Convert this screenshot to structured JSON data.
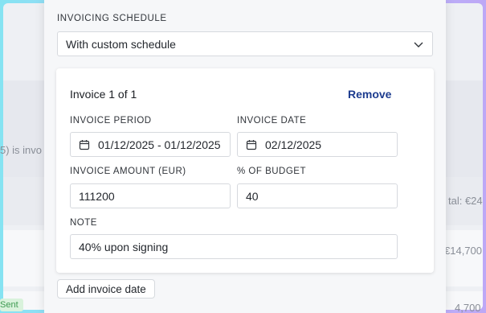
{
  "background": {
    "text_left": "5) is invo",
    "total_text": "tal: €24",
    "amount_row_1": "€14,700",
    "amount_row_2": "4,700",
    "status_badge": "Sent"
  },
  "modal": {
    "schedule_label": "INVOICING SCHEDULE",
    "schedule_value": "With custom schedule",
    "card": {
      "title": "Invoice 1 of 1",
      "remove_label": "Remove",
      "period_label": "INVOICE PERIOD",
      "period_value": "01/12/2025 - 01/12/2025",
      "date_label": "INVOICE DATE",
      "date_value": "02/12/2025",
      "amount_label": "INVOICE AMOUNT (EUR)",
      "amount_value": "111200",
      "budget_label": "% OF BUDGET",
      "budget_value": "40",
      "note_label": "NOTE",
      "note_value": "40% upon signing"
    },
    "add_button_label": "Add invoice date"
  },
  "icons": {
    "select_chevron": "chevron-down-icon",
    "calendar": "calendar-icon"
  }
}
